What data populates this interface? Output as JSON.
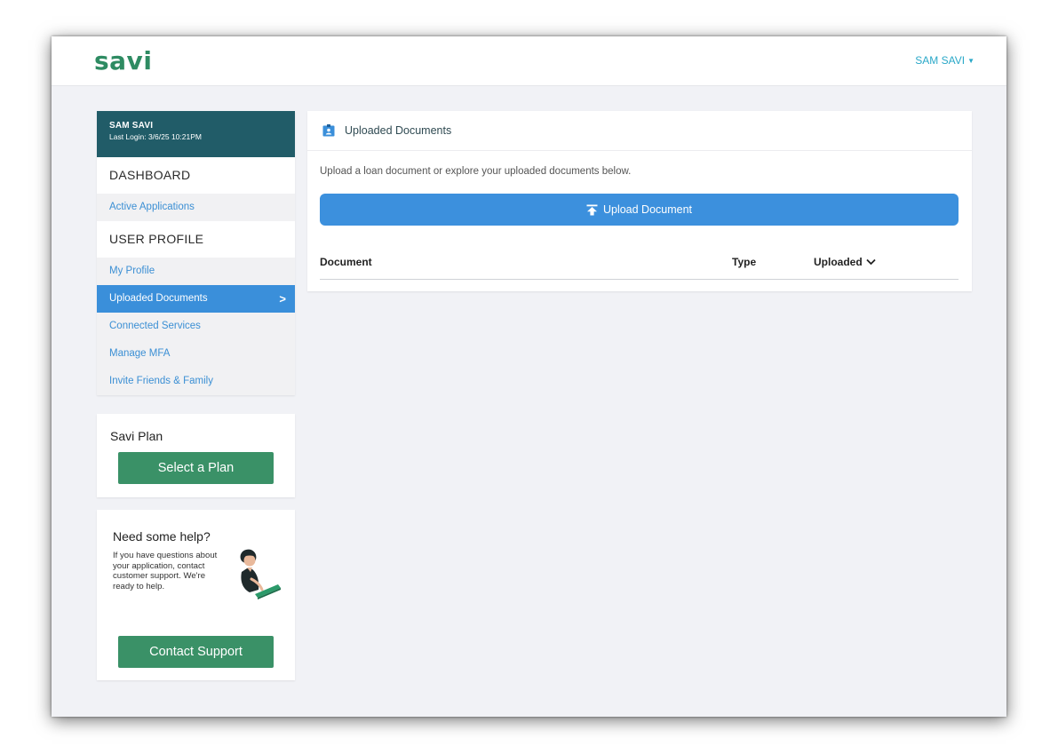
{
  "brand": {
    "logo_text": "savi",
    "color": "#2e8b62"
  },
  "header": {
    "user_menu_label": "SAM SAVI"
  },
  "sidebar": {
    "user_name": "SAM SAVI",
    "last_login": "Last Login: 3/6/25 10:21PM",
    "sections": {
      "dashboard": "DASHBOARD",
      "user_profile": "USER PROFILE"
    },
    "items": [
      {
        "label": "Active Applications"
      },
      {
        "label": "My Profile"
      },
      {
        "label": "Uploaded Documents",
        "active": true
      },
      {
        "label": "Connected Services"
      },
      {
        "label": "Manage MFA"
      },
      {
        "label": "Invite Friends & Family"
      }
    ],
    "active_color": "#3a8fda",
    "header_color": "#215c68"
  },
  "plan_card": {
    "title": "Savi Plan",
    "button_label": "Select a Plan"
  },
  "help_card": {
    "title": "Need some help?",
    "text": "If you have questions about your application, contact customer support. We're ready to help.",
    "button_label": "Contact Support"
  },
  "main": {
    "panel_title": "Uploaded Documents",
    "description": "Upload a loan document or explore your uploaded documents below.",
    "upload_button_label": "Upload Document",
    "table": {
      "columns": [
        "Document",
        "Type",
        "Uploaded"
      ],
      "rows": []
    }
  }
}
